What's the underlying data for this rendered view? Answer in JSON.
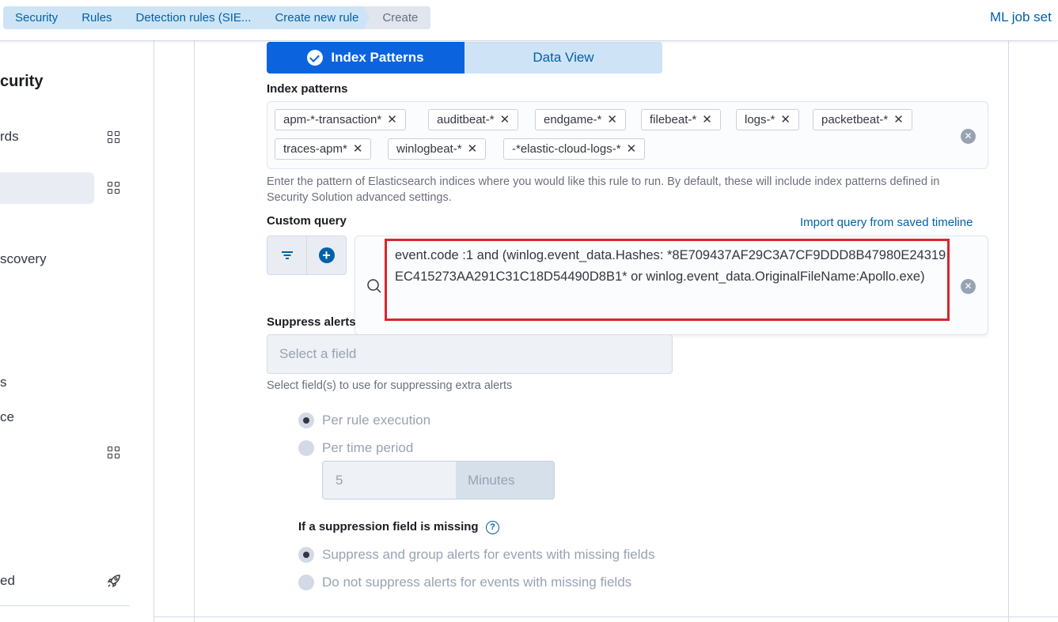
{
  "breadcrumbs": [
    "Security",
    "Rules",
    "Detection rules (SIE...",
    "Create new rule",
    "Create"
  ],
  "header": {
    "ml_job_settings": "ML job set"
  },
  "sidebar": {
    "title": "curity",
    "items": [
      {
        "label": "rds"
      },
      {
        "label": ""
      },
      {
        "label": "scovery"
      },
      {
        "label": "s"
      },
      {
        "label": "ce"
      },
      {
        "label": "ed"
      }
    ]
  },
  "source_toggle": {
    "index_patterns": "Index Patterns",
    "data_view": "Data View"
  },
  "index_patterns": {
    "label": "Index patterns",
    "values": [
      "apm-*-transaction*",
      "auditbeat-*",
      "endgame-*",
      "filebeat-*",
      "logs-*",
      "packetbeat-*",
      "traces-apm*",
      "winlogbeat-*",
      "-*elastic-cloud-logs-*"
    ],
    "help": "Enter the pattern of Elasticsearch indices where you would like this rule to run. By default, these will include index patterns defined in Security Solution advanced settings."
  },
  "custom_query": {
    "label": "Custom query",
    "import_link": "Import query from saved timeline",
    "value": "event.code :1 and (winlog.event_data.Hashes: *8E709437AF29C3A7CF9DDD8B47980E24319EC415273AA291C31C18D54490D8B1* or  winlog.event_data.OriginalFileName:Apollo.exe)"
  },
  "suppress": {
    "label": "Suppress alerts",
    "placeholder": "Select a field",
    "help": "Select field(s) to use for suppressing extra alerts",
    "per_rule_execution": "Per rule execution",
    "per_time_period": "Per time period",
    "duration_value": "5",
    "duration_unit": "Minutes",
    "missing_label": "If a suppression field is missing",
    "missing_group": "Suppress and group alerts for events with missing fields",
    "missing_no_suppress": "Do not suppress alerts for events with missing fields"
  },
  "colors": {
    "primary": "#0b64dd",
    "link": "#0061a6",
    "highlight": "#d8262d"
  }
}
